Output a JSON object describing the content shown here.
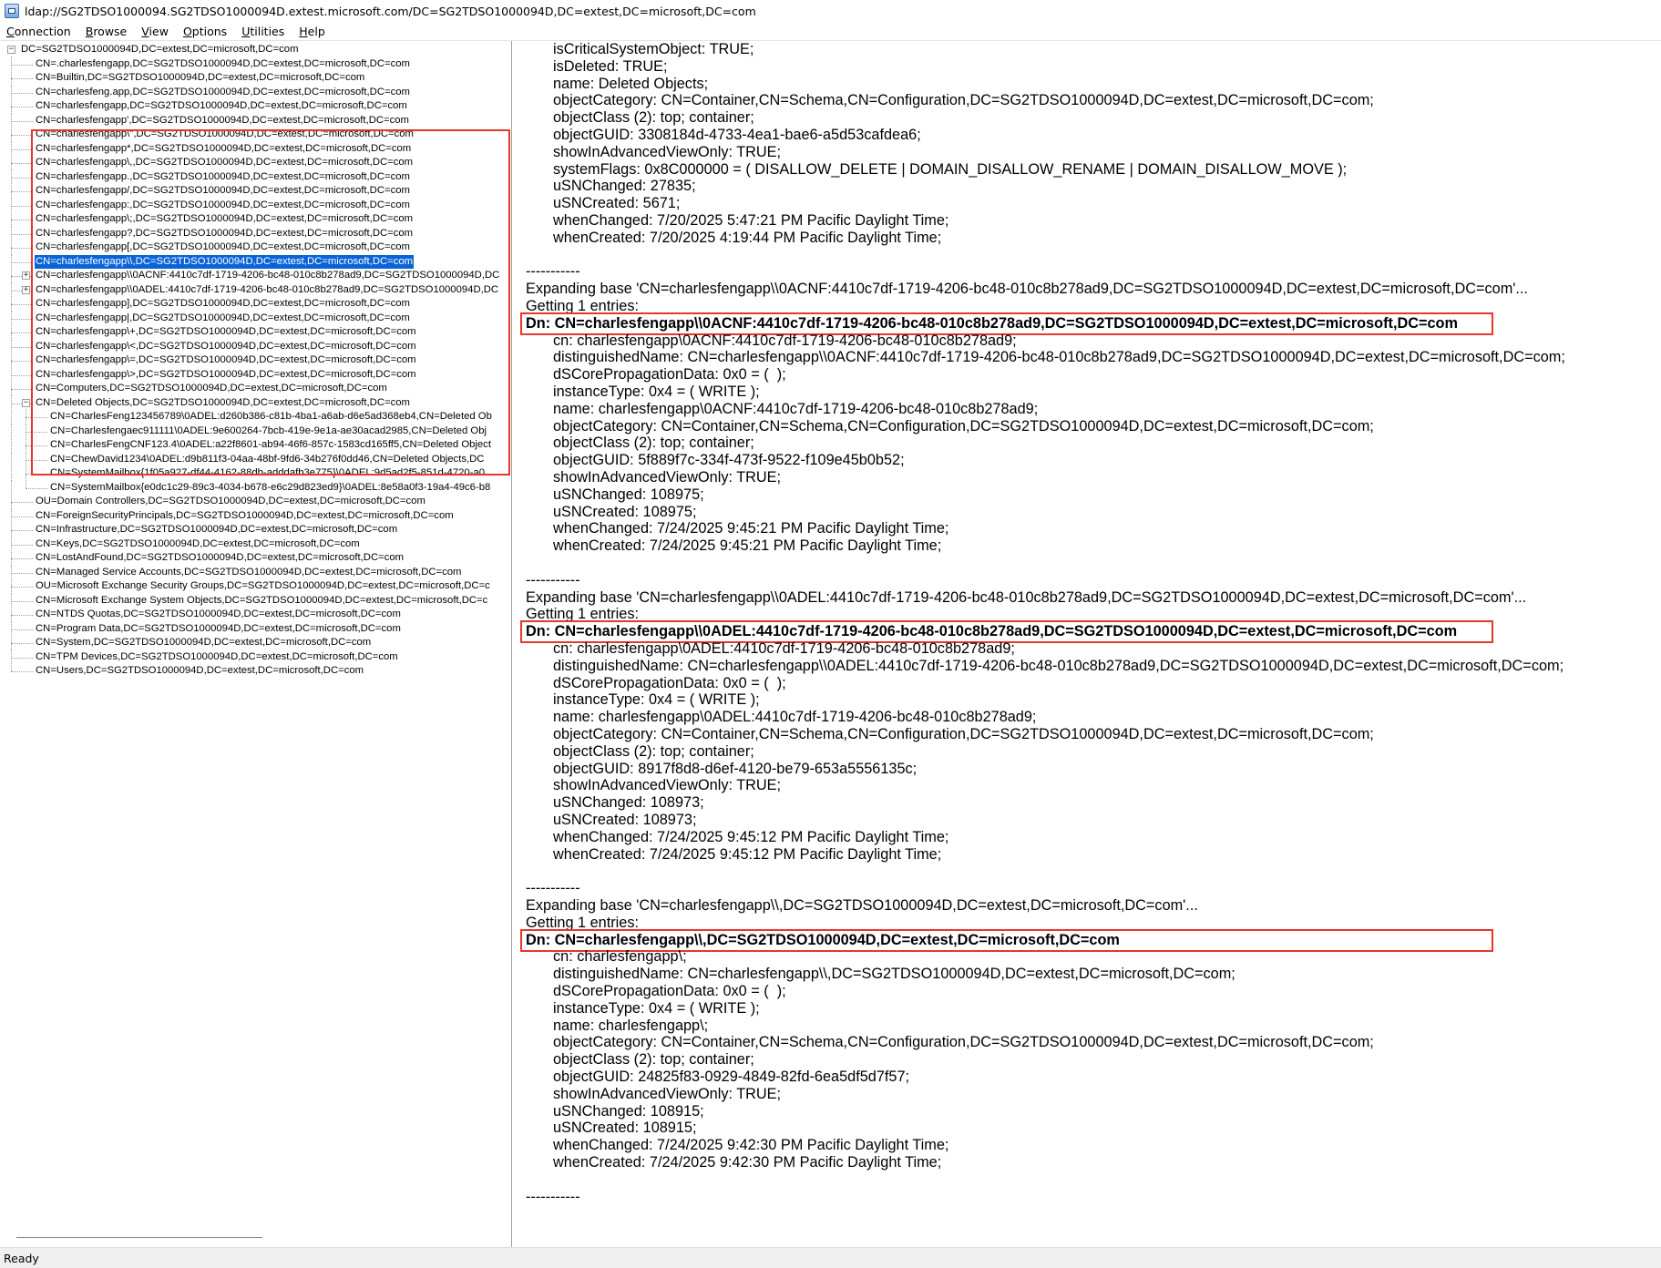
{
  "window": {
    "title": "ldap://SG2TDSO1000094.SG2TDSO1000094D.extest.microsoft.com/DC=SG2TDSO1000094D,DC=extest,DC=microsoft,DC=com"
  },
  "menubar": [
    {
      "label": "Connection",
      "accel": 0
    },
    {
      "label": "Browse",
      "accel": 0
    },
    {
      "label": "View",
      "accel": 0
    },
    {
      "label": "Options",
      "accel": 0
    },
    {
      "label": "Utilities",
      "accel": 0
    },
    {
      "label": "Help",
      "accel": 0
    }
  ],
  "tree": {
    "nodes": [
      {
        "text": "DC=SG2TDSO1000094D,DC=extest,DC=microsoft,DC=com",
        "level": 0,
        "expander": "-"
      },
      {
        "text": "CN=.charlesfengapp,DC=SG2TDSO1000094D,DC=extest,DC=microsoft,DC=com",
        "level": 1
      },
      {
        "text": "CN=Builtin,DC=SG2TDSO1000094D,DC=extest,DC=microsoft,DC=com",
        "level": 1
      },
      {
        "text": "CN=charlesfeng.app,DC=SG2TDSO1000094D,DC=extest,DC=microsoft,DC=com",
        "level": 1
      },
      {
        "text": "CN=charlesfengapp,DC=SG2TDSO1000094D,DC=extest,DC=microsoft,DC=com",
        "level": 1
      },
      {
        "text": "CN=charlesfengapp',DC=SG2TDSO1000094D,DC=extest,DC=microsoft,DC=com",
        "level": 1
      },
      {
        "text": "CN=charlesfengapp\\\",DC=SG2TDSO1000094D,DC=extest,DC=microsoft,DC=com",
        "level": 1
      },
      {
        "text": "CN=charlesfengapp*,DC=SG2TDSO1000094D,DC=extest,DC=microsoft,DC=com",
        "level": 1
      },
      {
        "text": "CN=charlesfengapp\\,,DC=SG2TDSO1000094D,DC=extest,DC=microsoft,DC=com",
        "level": 1
      },
      {
        "text": "CN=charlesfengapp.,DC=SG2TDSO1000094D,DC=extest,DC=microsoft,DC=com",
        "level": 1
      },
      {
        "text": "CN=charlesfengapp/,DC=SG2TDSO1000094D,DC=extest,DC=microsoft,DC=com",
        "level": 1
      },
      {
        "text": "CN=charlesfengapp:,DC=SG2TDSO1000094D,DC=extest,DC=microsoft,DC=com",
        "level": 1
      },
      {
        "text": "CN=charlesfengapp\\;,DC=SG2TDSO1000094D,DC=extest,DC=microsoft,DC=com",
        "level": 1
      },
      {
        "text": "CN=charlesfengapp?,DC=SG2TDSO1000094D,DC=extest,DC=microsoft,DC=com",
        "level": 1
      },
      {
        "text": "CN=charlesfengapp[,DC=SG2TDSO1000094D,DC=extest,DC=microsoft,DC=com",
        "level": 1
      },
      {
        "text": "CN=charlesfengapp\\\\,DC=SG2TDSO1000094D,DC=extest,DC=microsoft,DC=com",
        "level": 1,
        "selected": true
      },
      {
        "text": "CN=charlesfengapp\\\\0ACNF:4410c7df-1719-4206-bc48-010c8b278ad9,DC=SG2TDSO1000094D,DC",
        "level": 1,
        "expander": "+"
      },
      {
        "text": "CN=charlesfengapp\\\\0ADEL:4410c7df-1719-4206-bc48-010c8b278ad9,DC=SG2TDSO1000094D,DC",
        "level": 1,
        "expander": "+"
      },
      {
        "text": "CN=charlesfengapp],DC=SG2TDSO1000094D,DC=extest,DC=microsoft,DC=com",
        "level": 1
      },
      {
        "text": "CN=charlesfengapp|,DC=SG2TDSO1000094D,DC=extest,DC=microsoft,DC=com",
        "level": 1
      },
      {
        "text": "CN=charlesfengapp\\+,DC=SG2TDSO1000094D,DC=extest,DC=microsoft,DC=com",
        "level": 1
      },
      {
        "text": "CN=charlesfengapp\\<,DC=SG2TDSO1000094D,DC=extest,DC=microsoft,DC=com",
        "level": 1
      },
      {
        "text": "CN=charlesfengapp\\=,DC=SG2TDSO1000094D,DC=extest,DC=microsoft,DC=com",
        "level": 1
      },
      {
        "text": "CN=charlesfengapp\\>,DC=SG2TDSO1000094D,DC=extest,DC=microsoft,DC=com",
        "level": 1
      },
      {
        "text": "CN=Computers,DC=SG2TDSO1000094D,DC=extest,DC=microsoft,DC=com",
        "level": 1
      },
      {
        "text": "CN=Deleted Objects,DC=SG2TDSO1000094D,DC=extest,DC=microsoft,DC=com",
        "level": 1,
        "expander": "-"
      },
      {
        "text": "CN=CharlesFeng123456789\\0ADEL:d260b386-c81b-4ba1-a6ab-d6e5ad368eb4,CN=Deleted Ob",
        "level": 2
      },
      {
        "text": "CN=Charlesfengaec911111\\0ADEL:9e600264-7bcb-419e-9e1a-ae30acad2985,CN=Deleted Obj",
        "level": 2
      },
      {
        "text": "CN=CharlesFengCNF123.4\\0ADEL:a22f8601-ab94-46f6-857c-1583cd165ff5,CN=Deleted Object",
        "level": 2
      },
      {
        "text": "CN=ChewDavid1234\\0ADEL:d9b811f3-04aa-48bf-9fd6-34b276f0dd46,CN=Deleted Objects,DC",
        "level": 2
      },
      {
        "text": "CN=SystemMailbox{1f05a927-df44-4162-88db-adddafb3e775}\\0ADEL:9d5ad2f5-851d-4720-a0",
        "level": 2
      },
      {
        "text": "CN=SystemMailbox{e0dc1c29-89c3-4034-b678-e6c29d823ed9}\\0ADEL:8e58a0f3-19a4-49c6-b8",
        "level": 2
      },
      {
        "text": "OU=Domain Controllers,DC=SG2TDSO1000094D,DC=extest,DC=microsoft,DC=com",
        "level": 1
      },
      {
        "text": "CN=ForeignSecurityPrincipals,DC=SG2TDSO1000094D,DC=extest,DC=microsoft,DC=com",
        "level": 1
      },
      {
        "text": "CN=Infrastructure,DC=SG2TDSO1000094D,DC=extest,DC=microsoft,DC=com",
        "level": 1
      },
      {
        "text": "CN=Keys,DC=SG2TDSO1000094D,DC=extest,DC=microsoft,DC=com",
        "level": 1
      },
      {
        "text": "CN=LostAndFound,DC=SG2TDSO1000094D,DC=extest,DC=microsoft,DC=com",
        "level": 1
      },
      {
        "text": "CN=Managed Service Accounts,DC=SG2TDSO1000094D,DC=extest,DC=microsoft,DC=com",
        "level": 1
      },
      {
        "text": "OU=Microsoft Exchange Security Groups,DC=SG2TDSO1000094D,DC=extest,DC=microsoft,DC=c",
        "level": 1
      },
      {
        "text": "CN=Microsoft Exchange System Objects,DC=SG2TDSO1000094D,DC=extest,DC=microsoft,DC=c",
        "level": 1
      },
      {
        "text": "CN=NTDS Quotas,DC=SG2TDSO1000094D,DC=extest,DC=microsoft,DC=com",
        "level": 1
      },
      {
        "text": "CN=Program Data,DC=SG2TDSO1000094D,DC=extest,DC=microsoft,DC=com",
        "level": 1
      },
      {
        "text": "CN=System,DC=SG2TDSO1000094D,DC=extest,DC=microsoft,DC=com",
        "level": 1
      },
      {
        "text": "CN=TPM Devices,DC=SG2TDSO1000094D,DC=extest,DC=microsoft,DC=com",
        "level": 1
      },
      {
        "text": "CN=Users,DC=SG2TDSO1000094D,DC=extest,DC=microsoft,DC=com",
        "level": 1
      }
    ]
  },
  "details": {
    "lines": [
      {
        "text": "isCriticalSystemObject: TRUE;",
        "indent": true
      },
      {
        "text": "isDeleted: TRUE;",
        "indent": true
      },
      {
        "text": "name: Deleted Objects;",
        "indent": true
      },
      {
        "text": "objectCategory: CN=Container,CN=Schema,CN=Configuration,DC=SG2TDSO1000094D,DC=extest,DC=microsoft,DC=com;",
        "indent": true
      },
      {
        "text": "objectClass (2): top; container;",
        "indent": true
      },
      {
        "text": "objectGUID: 3308184d-4733-4ea1-bae6-a5d53cafdea6;",
        "indent": true
      },
      {
        "text": "showInAdvancedViewOnly: TRUE;",
        "indent": true
      },
      {
        "text": "systemFlags: 0x8C000000 = ( DISALLOW_DELETE | DOMAIN_DISALLOW_RENAME | DOMAIN_DISALLOW_MOVE );",
        "indent": true
      },
      {
        "text": "uSNChanged: 27835;",
        "indent": true
      },
      {
        "text": "uSNCreated: 5671;",
        "indent": true
      },
      {
        "text": "whenChanged: 7/20/2025 5:47:21 PM Pacific Daylight Time;",
        "indent": true
      },
      {
        "text": "whenCreated: 7/20/2025 4:19:44 PM Pacific Daylight Time;",
        "indent": true
      },
      {
        "text": ""
      },
      {
        "text": "-----------"
      },
      {
        "text": "Expanding base 'CN=charlesfengapp\\\\0ACNF:4410c7df-1719-4206-bc48-010c8b278ad9,DC=SG2TDSO1000094D,DC=extest,DC=microsoft,DC=com'..."
      },
      {
        "text": "Getting 1 entries:"
      },
      {
        "text": "Dn: CN=charlesfengapp\\\\0ACNF:4410c7df-1719-4206-bc48-010c8b278ad9,DC=SG2TDSO1000094D,DC=extest,DC=microsoft,DC=com",
        "bold": true,
        "boxed": true
      },
      {
        "text": "cn: charlesfengapp\\0ACNF:4410c7df-1719-4206-bc48-010c8b278ad9;",
        "indent": true
      },
      {
        "text": "distinguishedName: CN=charlesfengapp\\\\0ACNF:4410c7df-1719-4206-bc48-010c8b278ad9,DC=SG2TDSO1000094D,DC=extest,DC=microsoft,DC=com;",
        "indent": true
      },
      {
        "text": "dSCorePropagationData: 0x0 = (  );",
        "indent": true
      },
      {
        "text": "instanceType: 0x4 = ( WRITE );",
        "indent": true
      },
      {
        "text": "name: charlesfengapp\\0ACNF:4410c7df-1719-4206-bc48-010c8b278ad9;",
        "indent": true
      },
      {
        "text": "objectCategory: CN=Container,CN=Schema,CN=Configuration,DC=SG2TDSO1000094D,DC=extest,DC=microsoft,DC=com;",
        "indent": true
      },
      {
        "text": "objectClass (2): top; container;",
        "indent": true
      },
      {
        "text": "objectGUID: 5f889f7c-334f-473f-9522-f109e45b0b52;",
        "indent": true
      },
      {
        "text": "showInAdvancedViewOnly: TRUE;",
        "indent": true
      },
      {
        "text": "uSNChanged: 108975;",
        "indent": true
      },
      {
        "text": "uSNCreated: 108975;",
        "indent": true
      },
      {
        "text": "whenChanged: 7/24/2025 9:45:21 PM Pacific Daylight Time;",
        "indent": true
      },
      {
        "text": "whenCreated: 7/24/2025 9:45:21 PM Pacific Daylight Time;",
        "indent": true
      },
      {
        "text": ""
      },
      {
        "text": "-----------"
      },
      {
        "text": "Expanding base 'CN=charlesfengapp\\\\0ADEL:4410c7df-1719-4206-bc48-010c8b278ad9,DC=SG2TDSO1000094D,DC=extest,DC=microsoft,DC=com'..."
      },
      {
        "text": "Getting 1 entries:"
      },
      {
        "text": "Dn: CN=charlesfengapp\\\\0ADEL:4410c7df-1719-4206-bc48-010c8b278ad9,DC=SG2TDSO1000094D,DC=extest,DC=microsoft,DC=com",
        "bold": true,
        "boxed": true
      },
      {
        "text": "cn: charlesfengapp\\0ADEL:4410c7df-1719-4206-bc48-010c8b278ad9;",
        "indent": true
      },
      {
        "text": "distinguishedName: CN=charlesfengapp\\\\0ADEL:4410c7df-1719-4206-bc48-010c8b278ad9,DC=SG2TDSO1000094D,DC=extest,DC=microsoft,DC=com;",
        "indent": true
      },
      {
        "text": "dSCorePropagationData: 0x0 = (  );",
        "indent": true
      },
      {
        "text": "instanceType: 0x4 = ( WRITE );",
        "indent": true
      },
      {
        "text": "name: charlesfengapp\\0ADEL:4410c7df-1719-4206-bc48-010c8b278ad9;",
        "indent": true
      },
      {
        "text": "objectCategory: CN=Container,CN=Schema,CN=Configuration,DC=SG2TDSO1000094D,DC=extest,DC=microsoft,DC=com;",
        "indent": true
      },
      {
        "text": "objectClass (2): top; container;",
        "indent": true
      },
      {
        "text": "objectGUID: 8917f8d8-d6ef-4120-be79-653a5556135c;",
        "indent": true
      },
      {
        "text": "showInAdvancedViewOnly: TRUE;",
        "indent": true
      },
      {
        "text": "uSNChanged: 108973;",
        "indent": true
      },
      {
        "text": "uSNCreated: 108973;",
        "indent": true
      },
      {
        "text": "whenChanged: 7/24/2025 9:45:12 PM Pacific Daylight Time;",
        "indent": true
      },
      {
        "text": "whenCreated: 7/24/2025 9:45:12 PM Pacific Daylight Time;",
        "indent": true
      },
      {
        "text": ""
      },
      {
        "text": "-----------"
      },
      {
        "text": "Expanding base 'CN=charlesfengapp\\\\,DC=SG2TDSO1000094D,DC=extest,DC=microsoft,DC=com'..."
      },
      {
        "text": "Getting 1 entries:"
      },
      {
        "text": "Dn: CN=charlesfengapp\\\\,DC=SG2TDSO1000094D,DC=extest,DC=microsoft,DC=com",
        "bold": true,
        "boxed": true
      },
      {
        "text": "cn: charlesfengapp\\;",
        "indent": true
      },
      {
        "text": "distinguishedName: CN=charlesfengapp\\\\,DC=SG2TDSO1000094D,DC=extest,DC=microsoft,DC=com;",
        "indent": true
      },
      {
        "text": "dSCorePropagationData: 0x0 = (  );",
        "indent": true
      },
      {
        "text": "instanceType: 0x4 = ( WRITE );",
        "indent": true
      },
      {
        "text": "name: charlesfengapp\\;",
        "indent": true
      },
      {
        "text": "objectCategory: CN=Container,CN=Schema,CN=Configuration,DC=SG2TDSO1000094D,DC=extest,DC=microsoft,DC=com;",
        "indent": true
      },
      {
        "text": "objectClass (2): top; container;",
        "indent": true
      },
      {
        "text": "objectGUID: 24825f83-0929-4849-82fd-6ea5df5d7f57;",
        "indent": true
      },
      {
        "text": "showInAdvancedViewOnly: TRUE;",
        "indent": true
      },
      {
        "text": "uSNChanged: 108915;",
        "indent": true
      },
      {
        "text": "uSNCreated: 108915;",
        "indent": true
      },
      {
        "text": "whenChanged: 7/24/2025 9:42:30 PM Pacific Daylight Time;",
        "indent": true
      },
      {
        "text": "whenCreated: 7/24/2025 9:42:30 PM Pacific Daylight Time;",
        "indent": true
      },
      {
        "text": ""
      },
      {
        "text": "-----------"
      }
    ]
  },
  "status": {
    "text": "Ready"
  },
  "colors": {
    "highlight": "#e8362b",
    "selection": "#0a64d8"
  }
}
